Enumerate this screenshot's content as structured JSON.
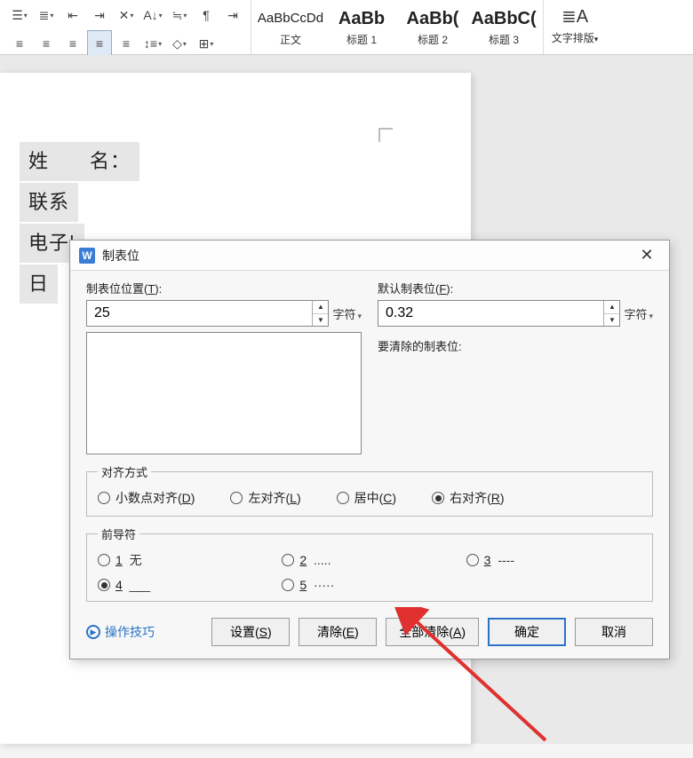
{
  "toolbar": {
    "styles": [
      {
        "sample": "AaBbCcDd",
        "cap": "正文",
        "big": false
      },
      {
        "sample": "AaBb",
        "cap": "标题 1",
        "big": true
      },
      {
        "sample": "AaBb(",
        "cap": "标题 2",
        "big": true
      },
      {
        "sample": "AaBbC(",
        "cap": "标题 3",
        "big": true
      }
    ],
    "layout_label": "文字排版"
  },
  "doc": {
    "rows": [
      "姓　　名：",
      "联系",
      "电子|",
      "日"
    ]
  },
  "dialog": {
    "title": "制表位",
    "pos_label_pre": "制表位位置(",
    "pos_label_hot": "T",
    "pos_label_suf": "):",
    "pos_value": "25",
    "pos_unit": "字符",
    "default_label_pre": "默认制表位(",
    "default_label_hot": "F",
    "default_label_suf": "):",
    "default_value": "0.32",
    "default_unit": "字符",
    "clear_list_label": "要清除的制表位:",
    "align": {
      "legend": "对齐方式",
      "items": [
        {
          "label_pre": "小数点对齐(",
          "hot": "D",
          "suf": ")",
          "checked": false
        },
        {
          "label_pre": "左对齐(",
          "hot": "L",
          "suf": ")",
          "checked": false
        },
        {
          "label_pre": "居中(",
          "hot": "C",
          "suf": ")",
          "checked": false
        },
        {
          "label_pre": "右对齐(",
          "hot": "R",
          "suf": ")",
          "checked": true
        }
      ]
    },
    "leader": {
      "legend": "前导符",
      "items": [
        {
          "hot": "1",
          "sample": " 无",
          "checked": false
        },
        {
          "hot": "2",
          "sample": " .....",
          "checked": false
        },
        {
          "hot": "3",
          "sample": " ----",
          "checked": false
        },
        {
          "hot": "4",
          "sample": " ___",
          "checked": true
        },
        {
          "hot": "5",
          "sample": " ·····",
          "checked": false
        }
      ]
    },
    "tips": "操作技巧",
    "buttons": {
      "set_pre": "设置(",
      "set_hot": "S",
      "set_suf": ")",
      "clear_pre": "清除(",
      "clear_hot": "E",
      "clear_suf": ")",
      "clearall_pre": "全部清除(",
      "clearall_hot": "A",
      "clearall_suf": ")",
      "ok": "确定",
      "cancel": "取消"
    }
  }
}
